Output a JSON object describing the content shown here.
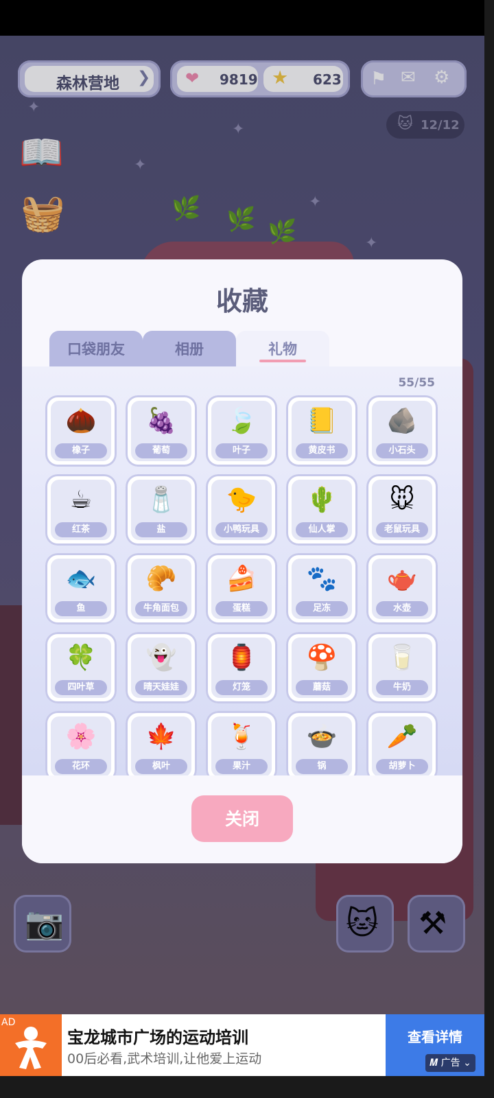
{
  "top_bar": {
    "camp_name": "森林营地",
    "hearts": "9819",
    "stars": "623",
    "cat_count": "12/12"
  },
  "collection": {
    "title": "收藏",
    "tabs": [
      {
        "label": "口袋朋友",
        "active": false
      },
      {
        "label": "相册",
        "active": false
      },
      {
        "label": "礼物",
        "active": true
      }
    ],
    "count": "55/55",
    "items": [
      {
        "label": "橡子",
        "icon": "acorn-icon",
        "glyph": "🌰"
      },
      {
        "label": "葡萄",
        "icon": "grape-icon",
        "glyph": "🍇"
      },
      {
        "label": "叶子",
        "icon": "leaf-icon",
        "glyph": "🍃"
      },
      {
        "label": "黄皮书",
        "icon": "yellow-book-icon",
        "glyph": "📒"
      },
      {
        "label": "小石头",
        "icon": "pebbles-icon",
        "glyph": "🪨"
      },
      {
        "label": "红茶",
        "icon": "tea-cup-icon",
        "glyph": "☕"
      },
      {
        "label": "盐",
        "icon": "salt-bottle-icon",
        "glyph": "🧂"
      },
      {
        "label": "小鸭玩具",
        "icon": "rubber-duck-icon",
        "glyph": "🐤"
      },
      {
        "label": "仙人掌",
        "icon": "cactus-icon",
        "glyph": "🌵"
      },
      {
        "label": "老鼠玩具",
        "icon": "mouse-toy-icon",
        "glyph": "🐭"
      },
      {
        "label": "鱼",
        "icon": "fish-icon",
        "glyph": "🐟"
      },
      {
        "label": "牛角面包",
        "icon": "croissant-icon",
        "glyph": "🥐"
      },
      {
        "label": "蛋糕",
        "icon": "cake-icon",
        "glyph": "🍰"
      },
      {
        "label": "足冻",
        "icon": "paw-jelly-icon",
        "glyph": "🐾"
      },
      {
        "label": "水壶",
        "icon": "teapot-icon",
        "glyph": "🫖"
      },
      {
        "label": "四叶草",
        "icon": "clover-icon",
        "glyph": "🍀"
      },
      {
        "label": "晴天娃娃",
        "icon": "teru-teru-bozu-icon",
        "glyph": "👻"
      },
      {
        "label": "灯笼",
        "icon": "lantern-icon",
        "glyph": "🏮"
      },
      {
        "label": "蘑菇",
        "icon": "mushroom-icon",
        "glyph": "🍄"
      },
      {
        "label": "牛奶",
        "icon": "milk-carton-icon",
        "glyph": "🥛"
      },
      {
        "label": "花环",
        "icon": "flower-wreath-icon",
        "glyph": "🌸"
      },
      {
        "label": "枫叶",
        "icon": "maple-leaf-icon",
        "glyph": "🍁"
      },
      {
        "label": "果汁",
        "icon": "juice-glass-icon",
        "glyph": "🍹"
      },
      {
        "label": "锅",
        "icon": "pot-icon",
        "glyph": "🍲"
      },
      {
        "label": "胡萝卜",
        "icon": "carrot-icon",
        "glyph": "🥕"
      }
    ],
    "close_label": "关闭"
  },
  "ad": {
    "badge": "AD",
    "title": "宝龙城市广场的运动培训",
    "subtitle": "00后必看,武术培训,让他爱上运动",
    "cta": "查看详情",
    "mark": "广告"
  },
  "colors": {
    "accent_pink": "#f7a9bf",
    "tab_lavender": "#b6b9e1",
    "ad_orange": "#f36f28",
    "ad_blue": "#3d7be7"
  }
}
